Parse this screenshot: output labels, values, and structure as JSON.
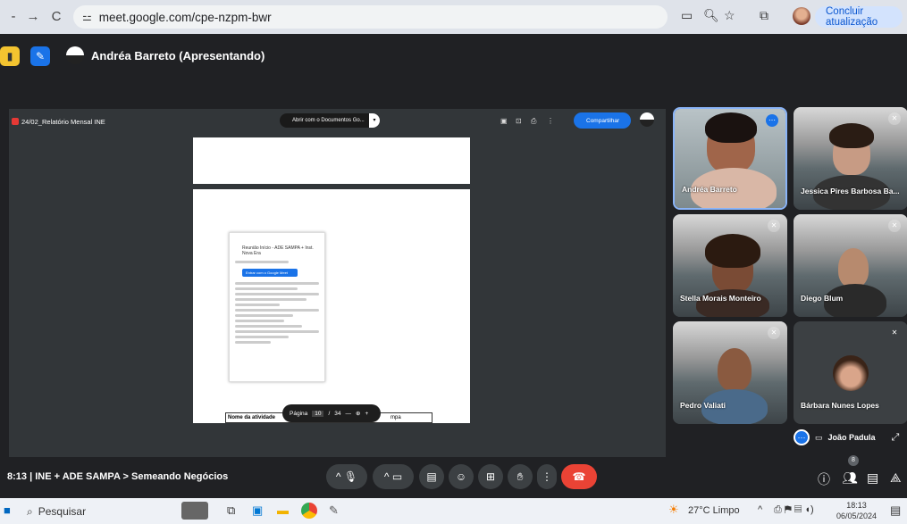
{
  "browser": {
    "url": "meet.google.com/cpe-nzpm-bwr",
    "update_label": "Concluir atualização"
  },
  "meet": {
    "presenter_label": "Andréa Barreto (Apresentando)",
    "meeting_time": "8:13",
    "meeting_title": "INE + ADE SAMPA > Semeando Negócios",
    "people_count": "8"
  },
  "presentation": {
    "doc_title": "24/02_Relatório Mensal INE",
    "open_with_label": "Abrir com o Documentos Go...",
    "share_label": "Compartilhar",
    "page_label": "Página",
    "page_current": "10",
    "page_sep": "/",
    "page_total": "34",
    "table_header_activity": "Nome da atividade",
    "table_header_fragment": "mpa",
    "event_title": "Reunião Início - ADE SAMPA + Inst. Nova Era",
    "event_button": "Entrar com o Google Meet"
  },
  "participants": [
    {
      "name": "Andréa Barreto"
    },
    {
      "name": "Jessica Pires Barbosa Ba..."
    },
    {
      "name": "Stella Morais Monteiro"
    },
    {
      "name": "Diego Blum"
    },
    {
      "name": "Pedro Valiati"
    },
    {
      "name": "Bárbara Nunes Lopes"
    },
    {
      "name": "João Padula"
    }
  ],
  "taskbar": {
    "search_placeholder": "Pesquisar",
    "weather": "27°C  Limpo",
    "time": "18:13",
    "date": "06/05/2024"
  },
  "colors": {
    "meet_bg": "#202124",
    "accent_blue": "#1a73e8",
    "end_call_red": "#ea4335",
    "active_speaker_border": "#8ab4f8"
  }
}
